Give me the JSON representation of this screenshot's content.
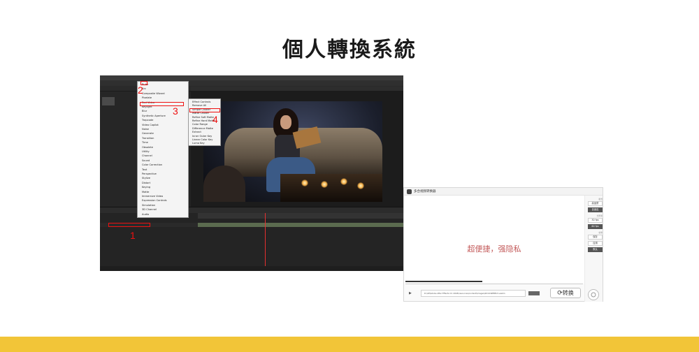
{
  "page_title": "個人轉換系統",
  "colors": {
    "accent_band": "#f2c538",
    "highlight": "#e11111",
    "slogan": "#c35a5a"
  },
  "ae": {
    "menu1_items": [
      "Ruler",
      "Arc",
      "Composite Wizard",
      "Pixelate",
      "Red Video",
      "Keylight",
      "Blur",
      "Synthetic Aperture",
      "Trapcode",
      "Video Copilot",
      "Noise",
      "Generate",
      "Transition",
      "Time",
      "Obsolete",
      "Utility",
      "Channel",
      "Sound",
      "Color Correction",
      "Text",
      "Perspective",
      "Stylize",
      "Distort",
      "Keying",
      "Matte",
      "Immersive Video",
      "Expression Controls",
      "Simulation",
      "3D Channel",
      "Audio"
    ],
    "menu2_items": [
      "Effect Controls",
      "Remove All",
      "Simple Choker",
      "Matte Choker",
      "Refine Soft Matte",
      "Refine Hard Matte",
      "Color Range",
      "Difference Matte",
      "Extract",
      "Inner Outer Key",
      "Linear Color Key",
      "Luma Key"
    ],
    "steps": [
      "1",
      "2",
      "3",
      "4"
    ]
  },
  "converter": {
    "window_title": "多合视频转换器",
    "slogan": "超便捷，强隐私",
    "side_labels": [
      "格式",
      "分辨率",
      "帧率"
    ],
    "side_buttons": [
      "高品质",
      "自适应",
      "30 fps",
      "60 fps",
      "保存",
      "应用",
      "默认"
    ],
    "path": "D:\\AE\\Adobe After Effects CC 2018\\resources\\content\\images\\2019-WEBM-5.webm",
    "convert_label": "转换",
    "convert_icon": "refresh-icon"
  }
}
